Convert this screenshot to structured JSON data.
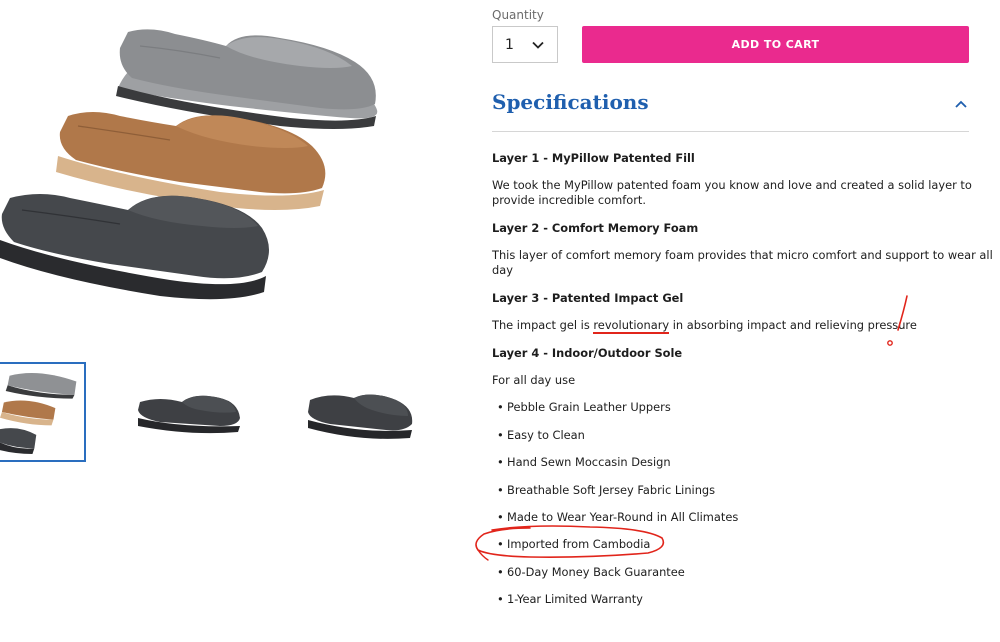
{
  "purchase": {
    "quantity_label": "Quantity",
    "quantity_value": "1",
    "add_to_cart_label": "ADD TO CART",
    "accent_color": "#ea2a8e"
  },
  "specifications": {
    "title": "Specifications",
    "title_color": "#1f5fae",
    "layers": [
      {
        "heading": "Layer 1 - MyPillow Patented Fill",
        "text_line1": "We took the MyPillow patented foam you know and love and created a solid layer to",
        "text_line2": "provide incredible comfort."
      },
      {
        "heading": "Layer 2 - Comfort Memory Foam",
        "text_line1": "This layer of comfort memory foam provides that micro comfort and support to wear all",
        "text_line2": "day"
      },
      {
        "heading": "Layer 3 - Patented Impact Gel",
        "text_before": "The impact gel is ",
        "text_highlight": "revolutionary",
        "text_after": " in absorbing impact and relieving pressure"
      },
      {
        "heading": "Layer 4 - Indoor/Outdoor Sole",
        "text": "For all day use"
      }
    ],
    "features": [
      "Pebble Grain Leather Uppers",
      "Easy to Clean",
      "Hand Sewn Moccasin Design",
      "Breathable Soft Jersey Fabric Linings",
      "Made to Wear Year-Round in All Climates",
      "Imported from Cambodia",
      "60-Day Money Back Guarantee",
      "1-Year Limited Warranty"
    ]
  },
  "gallery": {
    "selected_thumbnail": 1,
    "selected_border_color": "#2a6ebf",
    "shoe_colors": [
      "gray",
      "tan",
      "charcoal"
    ]
  },
  "annotations": {
    "ink_color": "#e1251b"
  }
}
